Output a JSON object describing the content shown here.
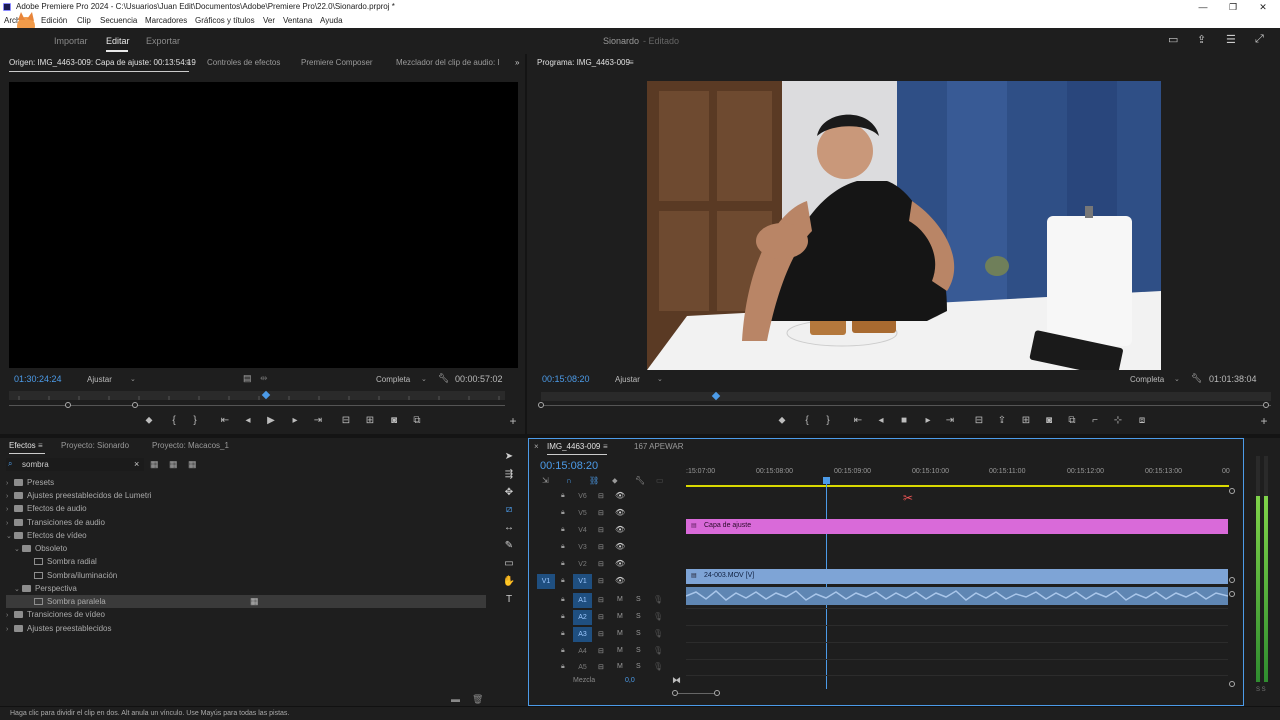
{
  "window": {
    "title": "Adobe Premiere Pro 2024 - C:\\Usuarios\\Juan Edit\\Documentos\\Adobe\\Premiere Pro\\22.0\\Sionardo.prproj *",
    "controls": [
      "—",
      "❐",
      "✕"
    ]
  },
  "menu": [
    "Archivo",
    "Edición",
    "Clip",
    "Secuencia",
    "Marcadores",
    "Gráficos y títulos",
    "Ver",
    "Ventana",
    "Ayuda"
  ],
  "workspace": {
    "tabs": [
      "Importar",
      "Editar",
      "Exportar"
    ],
    "active": "Editar",
    "project_name": "Sionardo",
    "project_state": "- Editado"
  },
  "source": {
    "tabs": [
      "Origen: IMG_4463-009: Capa de ajuste: 00:13:54:19",
      "Controles de efectos",
      "Premiere Composer",
      "Mezclador del clip de audio: IM("
    ],
    "timecode": "01:30:24:24",
    "fit": "Ajustar",
    "quality": "Completa",
    "duration": "00:00:57:02"
  },
  "program": {
    "tab": "Programa: IMG_4463-009",
    "timecode": "00:15:08:20",
    "fit": "Ajustar",
    "quality": "Completa",
    "duration": "01:01:38:04"
  },
  "effects": {
    "tabs": [
      "Efectos",
      "Proyecto: Sionardo",
      "Proyecto: Macacos_1"
    ],
    "search": "sombra",
    "tree": [
      {
        "label": "Presets",
        "level": 0,
        "type": "folder",
        "open": false
      },
      {
        "label": "Ajustes preestablecidos de Lumetri",
        "level": 0,
        "type": "folder",
        "open": false
      },
      {
        "label": "Efectos de audio",
        "level": 0,
        "type": "folder",
        "open": false
      },
      {
        "label": "Transiciones de audio",
        "level": 0,
        "type": "folder",
        "open": false
      },
      {
        "label": "Efectos de vídeo",
        "level": 0,
        "type": "folder",
        "open": true
      },
      {
        "label": "Obsoleto",
        "level": 1,
        "type": "folder",
        "open": true
      },
      {
        "label": "Sombra radial",
        "level": 2,
        "type": "fx"
      },
      {
        "label": "Sombra/iluminación",
        "level": 2,
        "type": "fx"
      },
      {
        "label": "Perspectiva",
        "level": 1,
        "type": "folder",
        "open": true
      },
      {
        "label": "Sombra paralela",
        "level": 2,
        "type": "fx",
        "selected": true
      },
      {
        "label": "Transiciones de vídeo",
        "level": 0,
        "type": "folder",
        "open": false
      },
      {
        "label": "Ajustes preestablecidos",
        "level": 0,
        "type": "folder",
        "open": false
      }
    ]
  },
  "timeline": {
    "tabs": [
      "IMG_4463-009",
      "167 APEWAR"
    ],
    "timecode": "00:15:08:20",
    "ruler": [
      ":15:07:00",
      "00:15:08:00",
      "00:15:09:00",
      "00:15:10:00",
      "00:15:11:00",
      "00:15:12:00",
      "00:15:13:00",
      "00"
    ],
    "video_tracks": [
      "V6",
      "V5",
      "V4",
      "V3",
      "V2",
      "V1"
    ],
    "audio_tracks": [
      "A1",
      "A2",
      "A3",
      "A4",
      "A5"
    ],
    "mix_label": "Mezcla",
    "mix_value": "0,0",
    "source_patch_v": "V1",
    "clip_adjust": "Capa de ajuste",
    "clip_video": "24-003.MOV [V]",
    "audio_meter": "S S"
  },
  "status": "Haga clic para dividir el clip en dos. Alt anula un vínculo. Use Mayús para todas las pistas.",
  "colors": {
    "accent": "#4c9be8",
    "adjustment_clip": "#d96ad9",
    "video_clip": "#7ea4d6",
    "audio_clip": "#5f86b3",
    "playhead": "#4c9be8"
  }
}
